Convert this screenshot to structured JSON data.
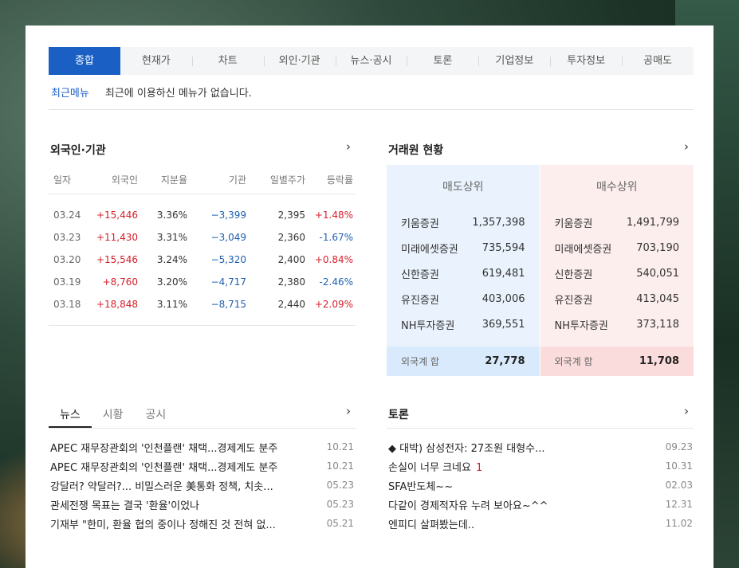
{
  "tabs": [
    "종합",
    "현재가",
    "차트",
    "외인·기관",
    "뉴스·공시",
    "토론",
    "기업정보",
    "투자정보",
    "공매도"
  ],
  "recent": {
    "label": "최근메뉴",
    "message": "최근에 이용하신 메뉴가 없습니다."
  },
  "foreign": {
    "title": "외국인·기관",
    "headers": [
      "일자",
      "외국인",
      "지분율",
      "기관",
      "일별주가",
      "등락률"
    ],
    "rows": [
      {
        "date": "03.24",
        "foreign": "+15,446",
        "ratio": "3.36%",
        "inst": "−3,399",
        "price": "2,395",
        "change": "+1.48%"
      },
      {
        "date": "03.23",
        "foreign": "+11,430",
        "ratio": "3.31%",
        "inst": "−3,049",
        "price": "2,360",
        "change": "-1.67%"
      },
      {
        "date": "03.20",
        "foreign": "+15,546",
        "ratio": "3.24%",
        "inst": "−5,320",
        "price": "2,400",
        "change": "+0.84%"
      },
      {
        "date": "03.19",
        "foreign": "+8,760",
        "ratio": "3.20%",
        "inst": "−4,717",
        "price": "2,380",
        "change": "-2.46%"
      },
      {
        "date": "03.18",
        "foreign": "+18,848",
        "ratio": "3.11%",
        "inst": "−8,715",
        "price": "2,440",
        "change": "+2.09%"
      }
    ]
  },
  "broker": {
    "title": "거래원 현황",
    "sell": {
      "header": "매도상위",
      "rows": [
        {
          "name": "키움증권",
          "value": "1,357,398"
        },
        {
          "name": "미래에셋증권",
          "value": "735,594"
        },
        {
          "name": "신한증권",
          "value": "619,481"
        },
        {
          "name": "유진증권",
          "value": "403,006"
        },
        {
          "name": "NH투자증권",
          "value": "369,551"
        }
      ],
      "total_label": "외국계 합",
      "total_value": "27,778"
    },
    "buy": {
      "header": "매수상위",
      "rows": [
        {
          "name": "키움증권",
          "value": "1,491,799"
        },
        {
          "name": "미래에셋증권",
          "value": "703,190"
        },
        {
          "name": "신한증권",
          "value": "540,051"
        },
        {
          "name": "유진증권",
          "value": "413,045"
        },
        {
          "name": "NH투자증권",
          "value": "373,118"
        }
      ],
      "total_label": "외국계 합",
      "total_value": "11,708"
    }
  },
  "news": {
    "tabs": [
      "뉴스",
      "시황",
      "공시"
    ],
    "items": [
      {
        "title": "APEC 재무장관회의 '인천플랜' 채택...경제계도 분주",
        "date": "10.21"
      },
      {
        "title": "APEC 재무장관회의 '인천플랜' 채택...경제계도 분주",
        "date": "10.21"
      },
      {
        "title": "강달러? 약달러?... 비밀스러운 美통화 정책, 치솟...",
        "date": "05.23"
      },
      {
        "title": "관세전쟁 목표는 결국 '환율'이었나",
        "date": "05.23"
      },
      {
        "title": "기재부 \"한미, 환율 협의 중이나 정해진 것 전혀 없...",
        "date": "05.21"
      }
    ]
  },
  "toron": {
    "title": "토론",
    "items": [
      {
        "title": "◆ 대박) 삼성전자: 27조원 대형수...",
        "count": "",
        "date": "09.23"
      },
      {
        "title": "손실이 너무 크네요",
        "count": "1",
        "date": "10.31"
      },
      {
        "title": "SFA반도체~~",
        "count": "",
        "date": "02.03"
      },
      {
        "title": "다같이 경제적자유 누려 보아요~^^",
        "count": "",
        "date": "12.31"
      },
      {
        "title": "엔피디 살펴봤는데..",
        "count": "",
        "date": "11.02"
      }
    ]
  },
  "icons": {
    "more": "chevron-right-icon"
  }
}
